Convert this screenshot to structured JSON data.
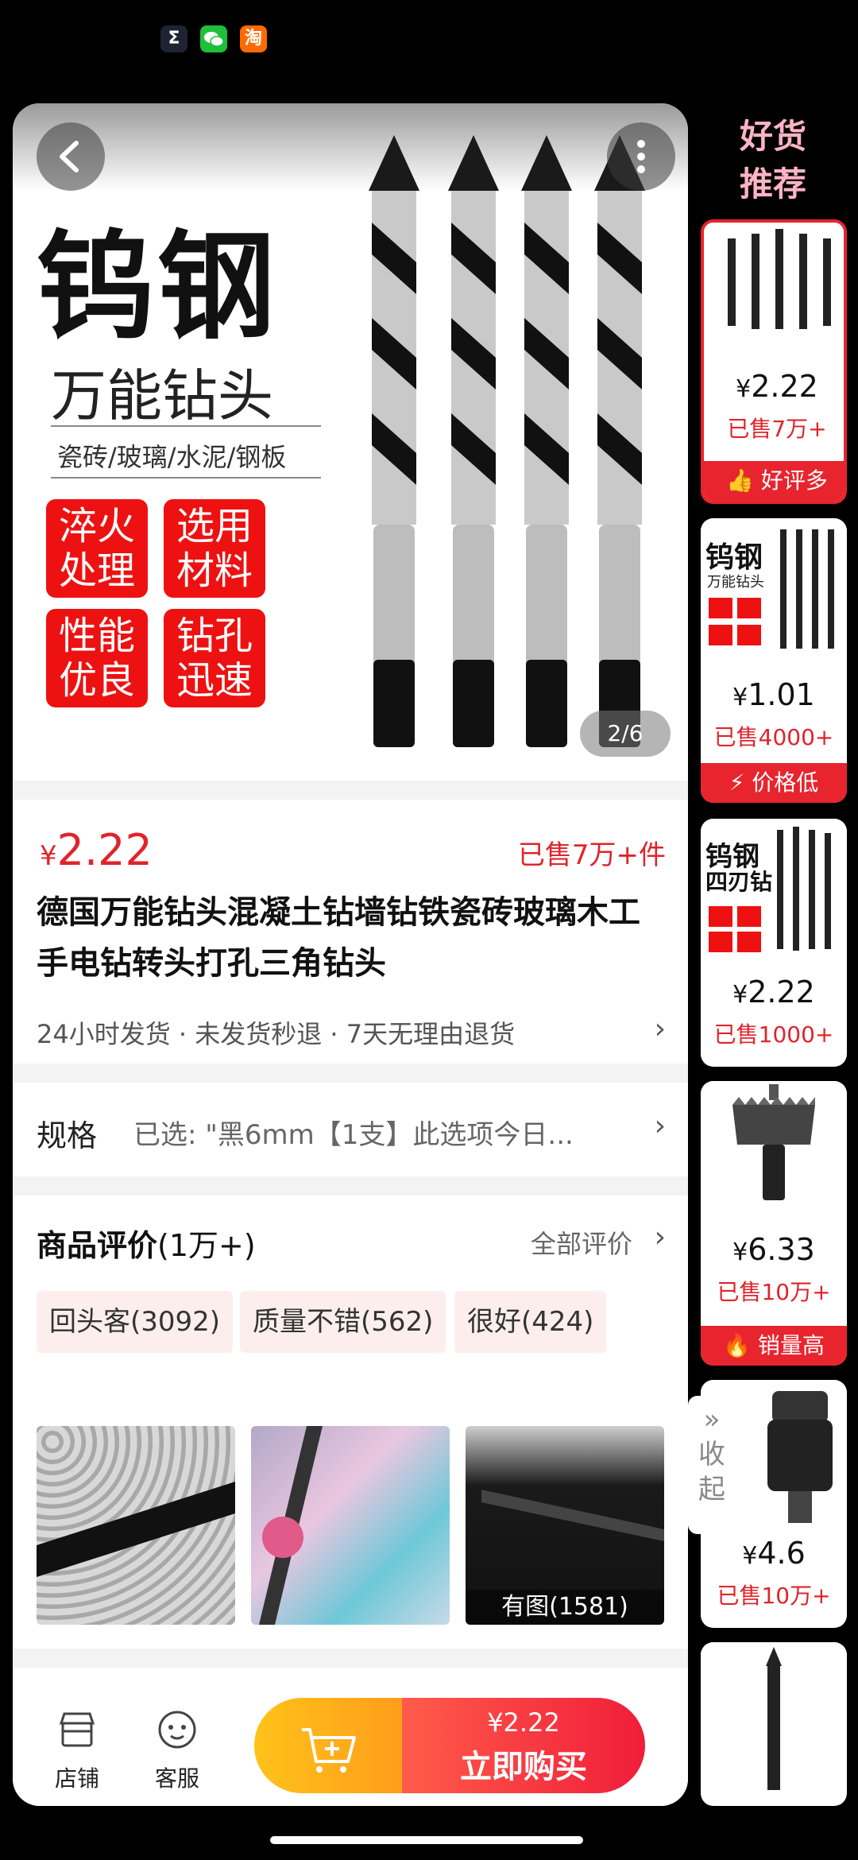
{
  "hero": {
    "title_big": "钨钢",
    "title_sub": "万能钻头",
    "materials": "瓷砖/玻璃/水泥/钢板",
    "badges": [
      "淬火\n处理",
      "选用\n材料",
      "性能\n优良",
      "钻孔\n迅速"
    ],
    "page_indicator": "2/6"
  },
  "product": {
    "currency": "¥",
    "price": "2.22",
    "sold": "已售7万+件",
    "title": "德国万能钻头混凝土钻墙钻铁瓷砖玻璃木工手电钻转头打孔三角钻头",
    "services": "24小时发货 · 未发货秒退 · 7天无理由退货"
  },
  "spec": {
    "label": "规格",
    "value": "已选: \"黑6mm【1支】此选项今日..."
  },
  "reviews": {
    "title": "商品评价",
    "count": "(1万+)",
    "all_label": "全部评价",
    "tags": [
      "回头客(3092)",
      "质量不错(562)",
      "很好(424)"
    ],
    "image_overlay": "有图(1581)"
  },
  "bottom_bar": {
    "shop_label": "店铺",
    "service_label": "客服",
    "buy_price": "¥2.22",
    "buy_label": "立即购买"
  },
  "side_panel": {
    "title_line1": "好货",
    "title_line2": "推荐",
    "collapse_label": "收\n起",
    "items": [
      {
        "price_cur": "¥",
        "price": "2.22",
        "sold": "已售7万+",
        "tag": "好评多"
      },
      {
        "price_cur": "¥",
        "price": "1.01",
        "sold": "已售4000+",
        "tag": "价格低"
      },
      {
        "price_cur": "¥",
        "price": "2.22",
        "sold": "已售1000+",
        "tag": ""
      },
      {
        "price_cur": "¥",
        "price": "6.33",
        "sold": "已售10万+",
        "tag": "销量高"
      },
      {
        "price_cur": "¥",
        "price": "4.6",
        "sold": "已售10万+",
        "tag": ""
      }
    ],
    "item2_title": "钨钢",
    "item2_sub": "万能钻头",
    "item3_title": "钨钢",
    "item3_sub": "四刃钻"
  },
  "colors": {
    "price_red": "#e0242c",
    "buy_start": "#ff5b4a",
    "buy_end": "#f01d3a",
    "cart_start": "#ffc21a",
    "cart_end": "#ff9e1a"
  }
}
